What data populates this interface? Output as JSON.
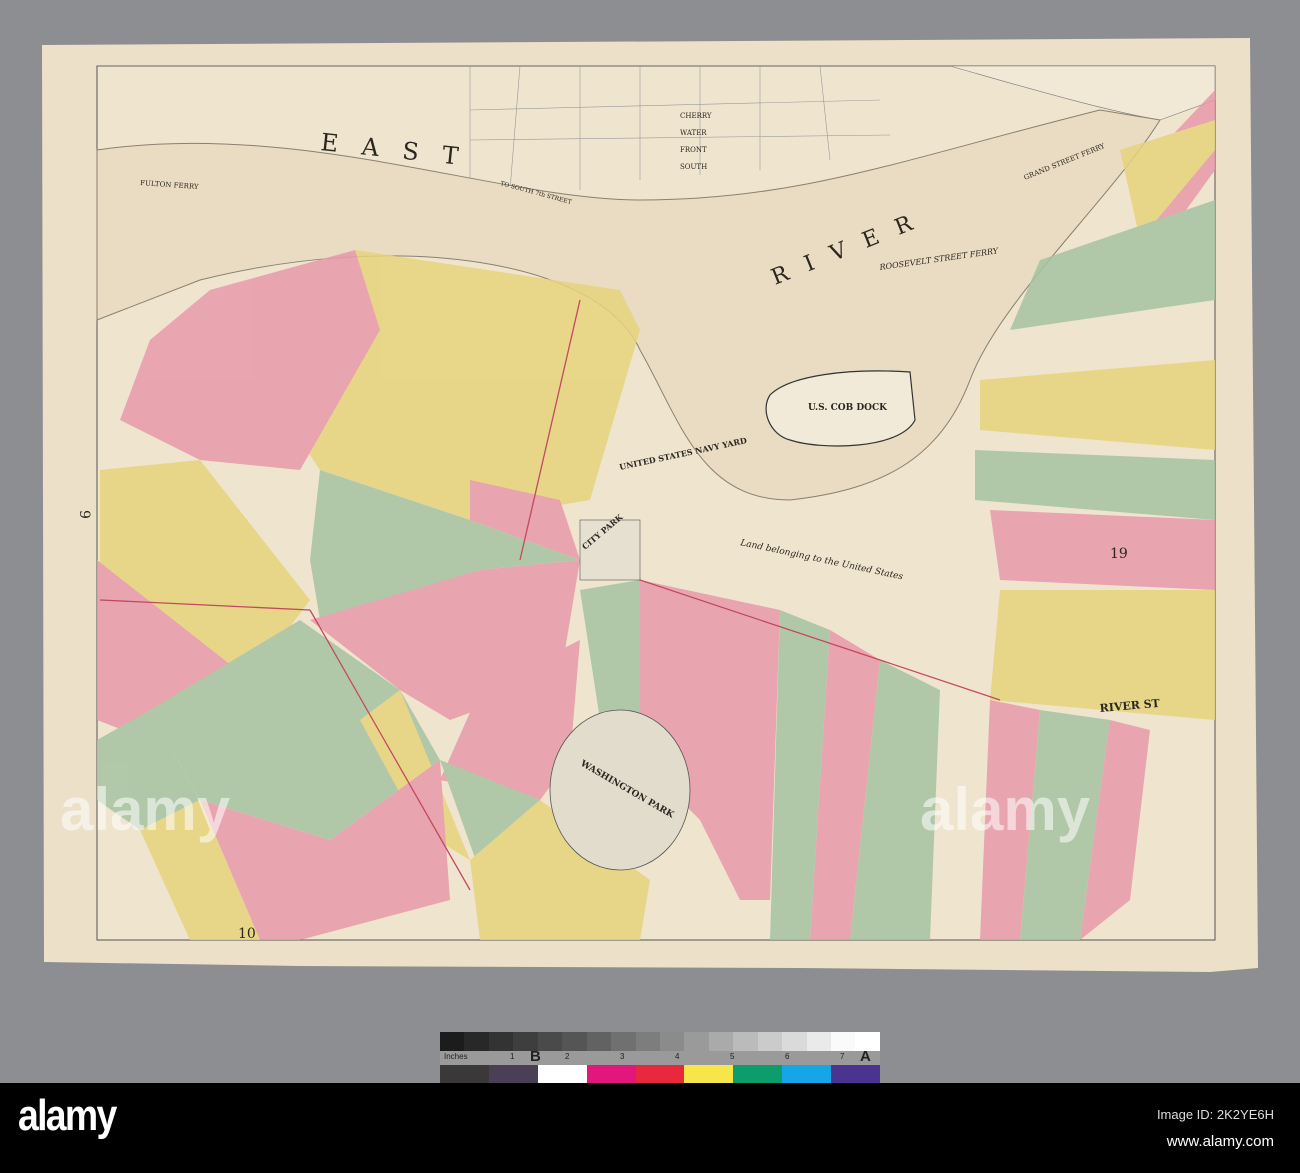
{
  "map": {
    "page_number": "9",
    "water": {
      "east": "E A S T",
      "river": "R I V E R"
    },
    "ferries": {
      "fulton": "FULTON FERRY",
      "roosevelt": "ROOSEVELT STREET FERRY",
      "grand": "GRAND STREET FERRY",
      "south_street": "TO SOUTH 7th STREET"
    },
    "manhattan_streets": [
      "CHERRY",
      "WATER",
      "FRONT",
      "SOUTH"
    ],
    "cob_dock": "U.S. COB DOCK",
    "navy_yard": "UNITED STATES NAVY YARD",
    "land_note": "Land belonging to the United States",
    "city_park": "CITY PARK",
    "washington_park": "WASHINGTON PARK",
    "river_street": "RIVER ST",
    "ward_numbers": [
      "19",
      "10"
    ],
    "colors": {
      "pink": "#e79aaa",
      "yellow": "#e6d47c",
      "green": "#a7c4a2",
      "paper": "#eee2cb"
    }
  },
  "color_target": {
    "ruler_label": "Inches",
    "ruler_numbers": [
      "1",
      "2",
      "3",
      "4",
      "5",
      "6",
      "7"
    ],
    "mark_b": "B",
    "mark_a": "A"
  },
  "watermark": {
    "logo": "alamy",
    "image_id": "Image ID: 2K2YE6H",
    "url": "www.alamy.com"
  }
}
